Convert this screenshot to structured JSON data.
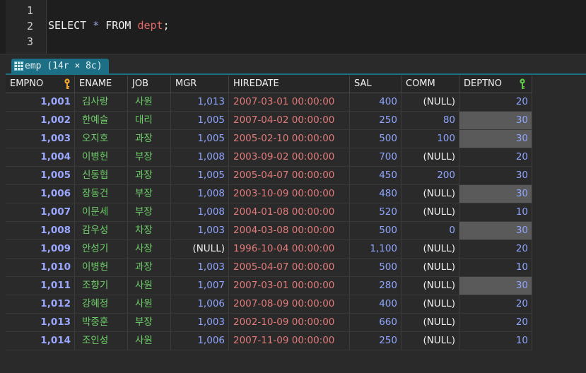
{
  "editor": {
    "lines": [
      "1",
      "2",
      "3"
    ],
    "code": {
      "keyword1": "SELECT",
      "op": "*",
      "keyword2": "FROM",
      "table": "dept",
      "semi": ";"
    }
  },
  "result_tab": {
    "label": "emp (14r × 8c)",
    "icon": "table-grid-icon"
  },
  "columns": [
    "EMPNO",
    "ENAME",
    "JOB",
    "MGR",
    "HIREDATE",
    "SAL",
    "COMM",
    "DEPTNO"
  ],
  "key_icons": {
    "EMPNO": "primary-key-icon",
    "DEPTNO": "foreign-key-icon"
  },
  "colors": {
    "tab": "#1d6f86",
    "number": "#8fa5ff",
    "text": "#6fcf6a",
    "date": "#e27a7a",
    "highlight": "#5a5a5a"
  },
  "rows": [
    {
      "empno": "1,001",
      "ename": "김사랑",
      "job": "사원",
      "mgr": "1,013",
      "hiredate": "2007-03-01 00:00:00",
      "sal": "400",
      "comm": "(NULL)",
      "deptno": "20",
      "hl": false
    },
    {
      "empno": "1,002",
      "ename": "한예슬",
      "job": "대리",
      "mgr": "1,005",
      "hiredate": "2007-04-02 00:00:00",
      "sal": "250",
      "comm": "80",
      "deptno": "30",
      "hl": true
    },
    {
      "empno": "1,003",
      "ename": "오지호",
      "job": "과장",
      "mgr": "1,005",
      "hiredate": "2005-02-10 00:00:00",
      "sal": "500",
      "comm": "100",
      "deptno": "30",
      "hl": true
    },
    {
      "empno": "1,004",
      "ename": "이병헌",
      "job": "부장",
      "mgr": "1,008",
      "hiredate": "2003-09-02 00:00:00",
      "sal": "700",
      "comm": "(NULL)",
      "deptno": "20",
      "hl": false
    },
    {
      "empno": "1,005",
      "ename": "신동협",
      "job": "과장",
      "mgr": "1,005",
      "hiredate": "2005-04-07 00:00:00",
      "sal": "450",
      "comm": "200",
      "deptno": "30",
      "hl": false
    },
    {
      "empno": "1,006",
      "ename": "장동건",
      "job": "부장",
      "mgr": "1,008",
      "hiredate": "2003-10-09 00:00:00",
      "sal": "480",
      "comm": "(NULL)",
      "deptno": "30",
      "hl": true
    },
    {
      "empno": "1,007",
      "ename": "이문세",
      "job": "부장",
      "mgr": "1,008",
      "hiredate": "2004-01-08 00:00:00",
      "sal": "520",
      "comm": "(NULL)",
      "deptno": "10",
      "hl": false
    },
    {
      "empno": "1,008",
      "ename": "감우성",
      "job": "차장",
      "mgr": "1,003",
      "hiredate": "2004-03-08 00:00:00",
      "sal": "500",
      "comm": "0",
      "deptno": "30",
      "hl": true
    },
    {
      "empno": "1,009",
      "ename": "안성기",
      "job": "사장",
      "mgr": "(NULL)",
      "hiredate": "1996-10-04 00:00:00",
      "sal": "1,100",
      "comm": "(NULL)",
      "deptno": "20",
      "hl": false
    },
    {
      "empno": "1,010",
      "ename": "이병헌",
      "job": "과장",
      "mgr": "1,003",
      "hiredate": "2005-04-07 00:00:00",
      "sal": "500",
      "comm": "(NULL)",
      "deptno": "10",
      "hl": false
    },
    {
      "empno": "1,011",
      "ename": "조향기",
      "job": "사원",
      "mgr": "1,007",
      "hiredate": "2007-03-01 00:00:00",
      "sal": "280",
      "comm": "(NULL)",
      "deptno": "30",
      "hl": true
    },
    {
      "empno": "1,012",
      "ename": "강혜정",
      "job": "사원",
      "mgr": "1,006",
      "hiredate": "2007-08-09 00:00:00",
      "sal": "400",
      "comm": "(NULL)",
      "deptno": "20",
      "hl": false
    },
    {
      "empno": "1,013",
      "ename": "박중훈",
      "job": "부장",
      "mgr": "1,003",
      "hiredate": "2002-10-09 00:00:00",
      "sal": "660",
      "comm": "(NULL)",
      "deptno": "20",
      "hl": false
    },
    {
      "empno": "1,014",
      "ename": "조인성",
      "job": "사원",
      "mgr": "1,006",
      "hiredate": "2007-11-09 00:00:00",
      "sal": "250",
      "comm": "(NULL)",
      "deptno": "10",
      "hl": false
    }
  ]
}
